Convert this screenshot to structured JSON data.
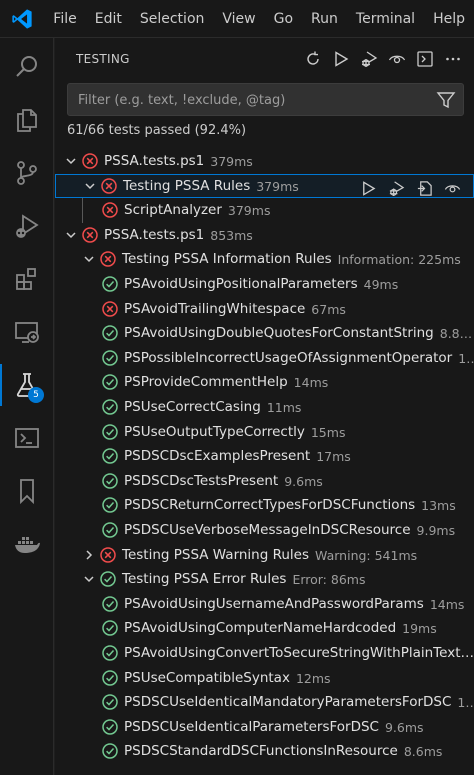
{
  "menu": [
    "File",
    "Edit",
    "Selection",
    "View",
    "Go",
    "Run",
    "Terminal",
    "Help"
  ],
  "activity_bar": {
    "items": [
      "search",
      "explorer",
      "source-control",
      "run-and-debug",
      "extensions",
      "remote-explorer",
      "testing",
      "powershell",
      "bookmarks",
      "docker"
    ],
    "testing_badge": "5"
  },
  "panel": {
    "title": "TESTING",
    "filter_placeholder": "Filter (e.g. text, !exclude, @tag)",
    "summary": "61/66 tests passed (92.4%)"
  },
  "tree": [
    {
      "level": 0,
      "expanded": true,
      "status": "fail",
      "label": "PSSA.tests.ps1",
      "desc": "379ms"
    },
    {
      "level": 1,
      "expanded": true,
      "status": "fail",
      "label": "Testing PSSA Rules",
      "desc": "379ms",
      "selected": true
    },
    {
      "level": 2,
      "status": "fail",
      "label": "ScriptAnalyzer",
      "desc": "379ms"
    },
    {
      "level": 0,
      "expanded": true,
      "status": "fail",
      "label": "PSSA.tests.ps1",
      "desc": "853ms"
    },
    {
      "level": 1,
      "expanded": true,
      "status": "fail",
      "label": "Testing PSSA Information Rules",
      "desc": "Information: 225ms"
    },
    {
      "level": 2,
      "status": "pass",
      "label": "PSAvoidUsingPositionalParameters",
      "desc": "49ms"
    },
    {
      "level": 2,
      "status": "fail",
      "label": "PSAvoidTrailingWhitespace",
      "desc": "67ms"
    },
    {
      "level": 2,
      "status": "pass",
      "label": "PSAvoidUsingDoubleQuotesForConstantString",
      "desc": "8.8ms"
    },
    {
      "level": 2,
      "status": "pass",
      "label": "PSPossibleIncorrectUsageOfAssignmentOperator",
      "desc": "1…"
    },
    {
      "level": 2,
      "status": "pass",
      "label": "PSProvideCommentHelp",
      "desc": "14ms"
    },
    {
      "level": 2,
      "status": "pass",
      "label": "PSUseCorrectCasing",
      "desc": "11ms"
    },
    {
      "level": 2,
      "status": "pass",
      "label": "PSUseOutputTypeCorrectly",
      "desc": "15ms"
    },
    {
      "level": 2,
      "status": "pass",
      "label": "PSDSCDscExamplesPresent",
      "desc": "17ms"
    },
    {
      "level": 2,
      "status": "pass",
      "label": "PSDSCDscTestsPresent",
      "desc": "9.6ms"
    },
    {
      "level": 2,
      "status": "pass",
      "label": "PSDSCReturnCorrectTypesForDSCFunctions",
      "desc": "13ms"
    },
    {
      "level": 2,
      "status": "pass",
      "label": "PSDSCUseVerboseMessageInDSCResource",
      "desc": "9.9ms"
    },
    {
      "level": 1,
      "expanded": false,
      "status": "fail",
      "label": "Testing PSSA Warning Rules",
      "desc": "Warning: 541ms"
    },
    {
      "level": 1,
      "expanded": true,
      "status": "pass",
      "label": "Testing PSSA Error Rules",
      "desc": "Error: 86ms"
    },
    {
      "level": 2,
      "status": "pass",
      "label": "PSAvoidUsingUsernameAndPasswordParams",
      "desc": "14ms"
    },
    {
      "level": 2,
      "status": "pass",
      "label": "PSAvoidUsingComputerNameHardcoded",
      "desc": "19ms"
    },
    {
      "level": 2,
      "status": "pass",
      "label": "PSAvoidUsingConvertToSecureStringWithPlainText…",
      "desc": ""
    },
    {
      "level": 2,
      "status": "pass",
      "label": "PSUseCompatibleSyntax",
      "desc": "12ms"
    },
    {
      "level": 2,
      "status": "pass",
      "label": "PSDSCUseIdenticalMandatoryParametersForDSC",
      "desc": "14…"
    },
    {
      "level": 2,
      "status": "pass",
      "label": "PSDSCUseIdenticalParametersForDSC",
      "desc": "9.6ms"
    },
    {
      "level": 2,
      "status": "pass",
      "label": "PSDSCStandardDSCFunctionsInResource",
      "desc": "8.6ms"
    }
  ],
  "colors": {
    "accent": "#0078d4",
    "fail": "#f14c4c",
    "pass": "#73c991",
    "logo": "#0098ff"
  }
}
